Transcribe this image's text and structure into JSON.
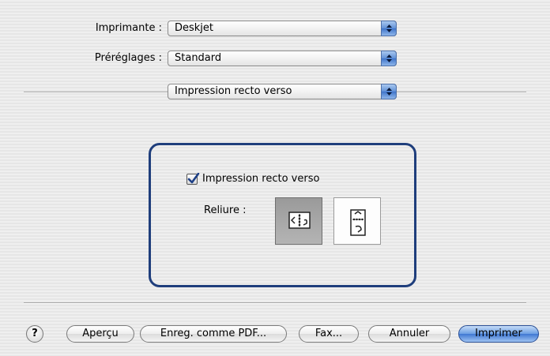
{
  "header": {
    "printer_label": "Imprimante :",
    "printer_value": "Deskjet",
    "presets_label": "Préréglages :",
    "presets_value": "Standard",
    "panel_value": "Impression recto verso"
  },
  "duplex": {
    "checkbox_label": "Impression recto verso",
    "checkbox_checked": true,
    "binding_label": "Reliure :",
    "binding_options": [
      "long-edge-binding-icon",
      "short-edge-binding-icon"
    ],
    "selected_binding": "long-edge-binding-icon"
  },
  "footer": {
    "help_glyph": "?",
    "preview": "Aperçu",
    "save_pdf": "Enreg. comme PDF...",
    "fax": "Fax...",
    "cancel": "Annuler",
    "print": "Imprimer"
  },
  "colors": {
    "accent": "#3e74c9",
    "group_border": "#1f3e7c"
  }
}
